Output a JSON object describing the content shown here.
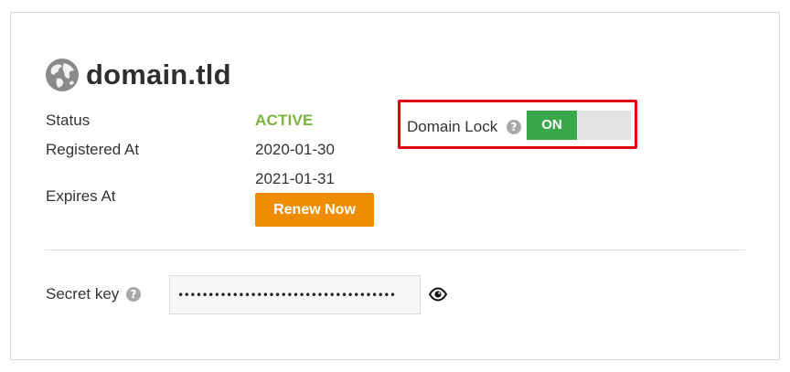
{
  "domain": {
    "name": "domain.tld",
    "icon": "globe-icon"
  },
  "details": {
    "status_label": "Status",
    "status_value": "ACTIVE",
    "status_color": "#7cb342",
    "registered_label": "Registered At",
    "registered_value": "2020-01-30",
    "expires_label": "Expires At",
    "expires_value": "2021-01-31",
    "renew_label": "Renew Now",
    "renew_color": "#f08c00"
  },
  "domain_lock": {
    "label": "Domain Lock",
    "help_icon": "question-circle-icon",
    "toggle_text": "ON",
    "enabled": true,
    "on_color": "#3aa84a",
    "highlight_color": "#e8000b"
  },
  "secret": {
    "label": "Secret key",
    "help_icon": "question-circle-icon",
    "value": "••••••••••••••••••••••••••••••••••••",
    "reveal_icon": "eye-icon"
  }
}
